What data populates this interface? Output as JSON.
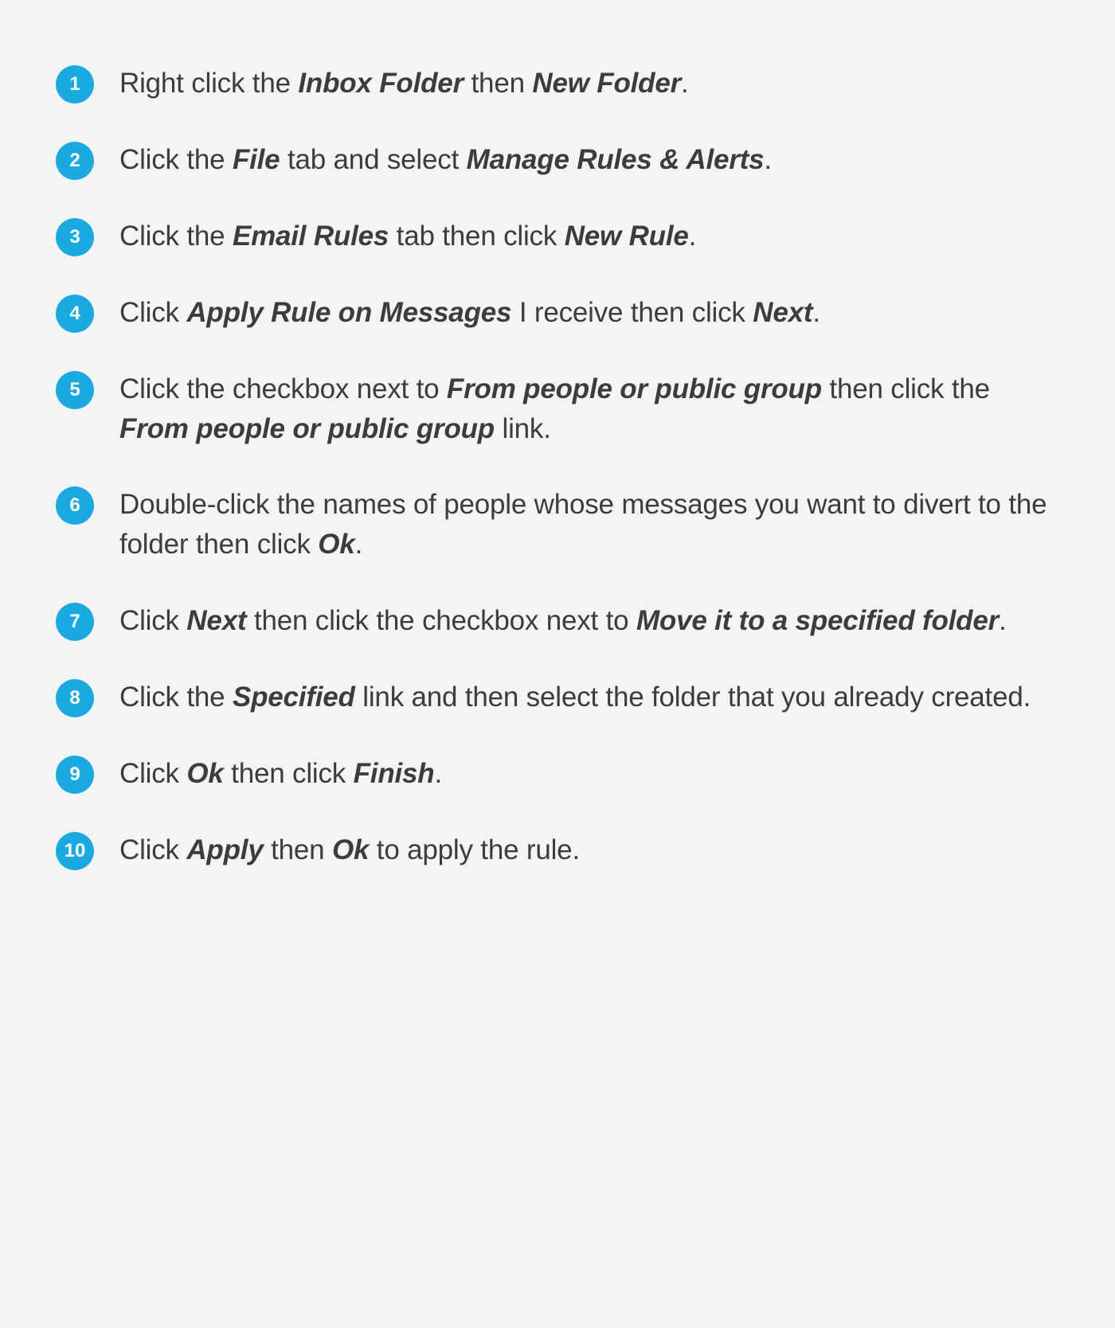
{
  "colors": {
    "background": "#f4f4f4",
    "badge": "#1ba9e1",
    "text": "#3c3c3c"
  },
  "steps": [
    {
      "number": "1",
      "segments": [
        {
          "t": "Right click the "
        },
        {
          "t": "Inbox Folder",
          "bi": true
        },
        {
          "t": " then "
        },
        {
          "t": "New Folder",
          "bi": true
        },
        {
          "t": "."
        }
      ]
    },
    {
      "number": "2",
      "segments": [
        {
          "t": "Click the "
        },
        {
          "t": "File",
          "bi": true
        },
        {
          "t": " tab and select "
        },
        {
          "t": "Manage Rules & Alerts",
          "bi": true
        },
        {
          "t": "."
        }
      ]
    },
    {
      "number": "3",
      "segments": [
        {
          "t": "Click the "
        },
        {
          "t": "Email Rules",
          "bi": true
        },
        {
          "t": " tab then click "
        },
        {
          "t": "New Rule",
          "bi": true
        },
        {
          "t": "."
        }
      ]
    },
    {
      "number": "4",
      "segments": [
        {
          "t": "Click "
        },
        {
          "t": "Apply Rule on Messages",
          "bi": true
        },
        {
          "t": " I receive then click "
        },
        {
          "t": "Next",
          "bi": true
        },
        {
          "t": "."
        }
      ]
    },
    {
      "number": "5",
      "segments": [
        {
          "t": "Click the checkbox next to "
        },
        {
          "t": "From people or public group",
          "bi": true
        },
        {
          "t": " then click the "
        },
        {
          "t": "From people or public group",
          "bi": true
        },
        {
          "t": " link."
        }
      ]
    },
    {
      "number": "6",
      "segments": [
        {
          "t": "Double-click the names of people whose messages you want to divert to the folder then click "
        },
        {
          "t": "Ok",
          "bi": true
        },
        {
          "t": "."
        }
      ]
    },
    {
      "number": "7",
      "segments": [
        {
          "t": "Click "
        },
        {
          "t": "Next",
          "bi": true
        },
        {
          "t": " then click the checkbox next to "
        },
        {
          "t": "Move it to a specified folder",
          "bi": true
        },
        {
          "t": "."
        }
      ]
    },
    {
      "number": "8",
      "segments": [
        {
          "t": "Click the "
        },
        {
          "t": "Specified",
          "bi": true
        },
        {
          "t": " link and then select the folder that you already created."
        }
      ]
    },
    {
      "number": "9",
      "segments": [
        {
          "t": "Click "
        },
        {
          "t": "Ok",
          "bi": true
        },
        {
          "t": " then click "
        },
        {
          "t": "Finish",
          "bi": true
        },
        {
          "t": "."
        }
      ]
    },
    {
      "number": "10",
      "segments": [
        {
          "t": "Click "
        },
        {
          "t": "Apply",
          "bi": true
        },
        {
          "t": " then "
        },
        {
          "t": "Ok",
          "bi": true
        },
        {
          "t": " to apply the rule."
        }
      ]
    }
  ]
}
